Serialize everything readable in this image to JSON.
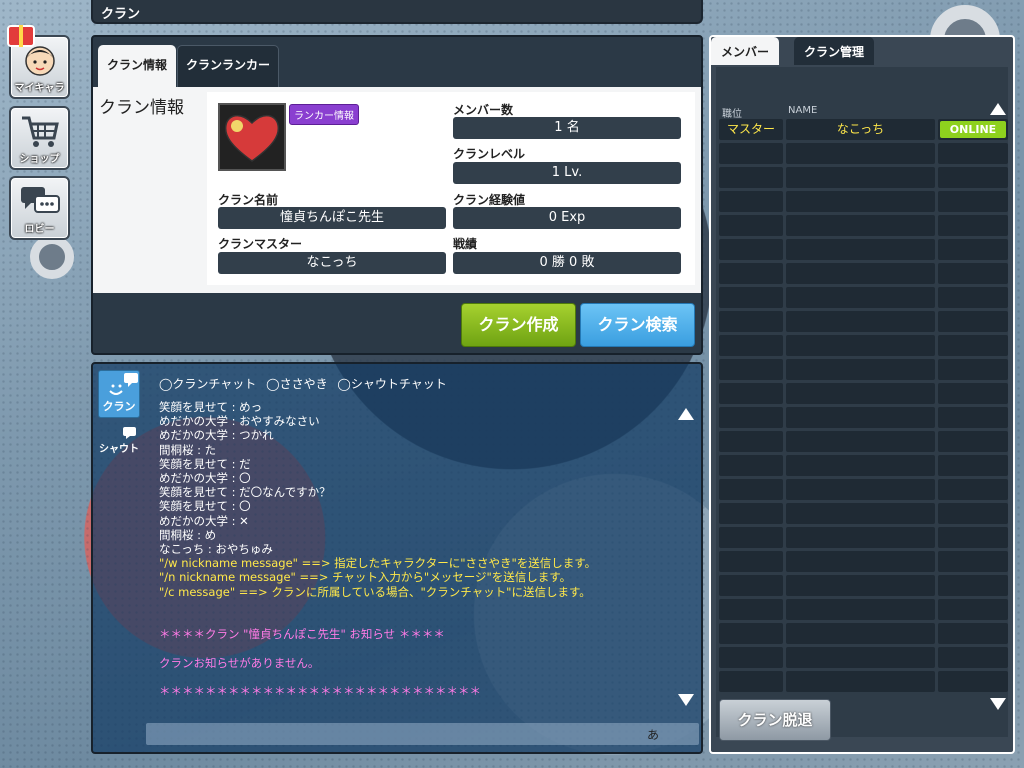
{
  "top_bar": {
    "title": "クラン"
  },
  "nav": {
    "my_char": "マイキャラ",
    "shop": "ショップ",
    "lobby": "ロビー"
  },
  "info_panel": {
    "tabs": [
      "クラン情報",
      "クランランカー"
    ],
    "section_title": "クラン情報",
    "ranker_badge": "ランカー情報",
    "member_count_label": "メンバー数",
    "member_count_value": "1 名",
    "clan_level_label": "クランレベル",
    "clan_level_value": "1 Lv.",
    "clan_name_label": "クラン名前",
    "clan_name_value": "憧貞ちんぽこ先生",
    "clan_exp_label": "クラン経験値",
    "clan_exp_value": "0 Exp",
    "clan_master_label": "クランマスター",
    "clan_master_value": "なこっち",
    "record_label": "戦績",
    "record_value": "0 勝  0 敗",
    "create_button": "クラン作成",
    "search_button": "クラン検索"
  },
  "chat": {
    "clan_button": "クラン",
    "shout_button": "シャウト",
    "modes": [
      "◯クランチャット",
      "◯ささやき",
      "◯シャウトチャット"
    ],
    "log": [
      {
        "text": "笑顔を見せて : めっ",
        "kind": "normal"
      },
      {
        "text": "めだかの大学 : おやすみなさい",
        "kind": "normal"
      },
      {
        "text": "めだかの大学 : つかれ",
        "kind": "normal"
      },
      {
        "text": "間桐桜 : た",
        "kind": "normal"
      },
      {
        "text": "笑顔を見せて : だ",
        "kind": "normal"
      },
      {
        "text": "めだかの大学 : 〇",
        "kind": "normal"
      },
      {
        "text": "笑顔を見せて : だ〇なんですか？",
        "kind": "normal"
      },
      {
        "text": "笑顔を見せて : 〇",
        "kind": "normal"
      },
      {
        "text": "めだかの大学 : ✕",
        "kind": "normal"
      },
      {
        "text": "間桐桜 : め",
        "kind": "normal"
      },
      {
        "text": "なこっち : おやちゅみ",
        "kind": "normal"
      },
      {
        "text": "\"/w nickname message\" ==> 指定したキャラクターに\"ささやき\"を送信します。",
        "kind": "help"
      },
      {
        "text": "\"/n nickname message\" ==> チャット入力から\"メッセージ\"を送信します。",
        "kind": "help"
      },
      {
        "text": "\"/c message\" ==> クランに所属している場合、\"クランチャット\"に送信します。",
        "kind": "help"
      },
      {
        "text": "",
        "kind": "spacer"
      },
      {
        "text": "",
        "kind": "spacer"
      },
      {
        "text": "＊＊＊＊クラン \"憧貞ちんぽこ先生\" お知らせ ＊＊＊＊",
        "kind": "notice"
      },
      {
        "text": "",
        "kind": "spacer"
      },
      {
        "text": "クランお知らせがありません。",
        "kind": "notice"
      },
      {
        "text": "",
        "kind": "spacer"
      },
      {
        "text": "＊＊＊＊＊＊＊＊＊＊＊＊＊＊＊＊＊＊＊＊＊＊＊＊＊＊＊＊",
        "kind": "notice"
      }
    ],
    "input_value": "",
    "ime_indicator": "あ"
  },
  "member_panel": {
    "tabs": [
      "メンバー",
      "クラン管理"
    ],
    "header_rank": "職位",
    "header_name": "NAME",
    "members": [
      {
        "rank": "マスター",
        "name": "なこっち",
        "status": "ONLINE"
      }
    ],
    "leave_button": "クラン脱退"
  }
}
